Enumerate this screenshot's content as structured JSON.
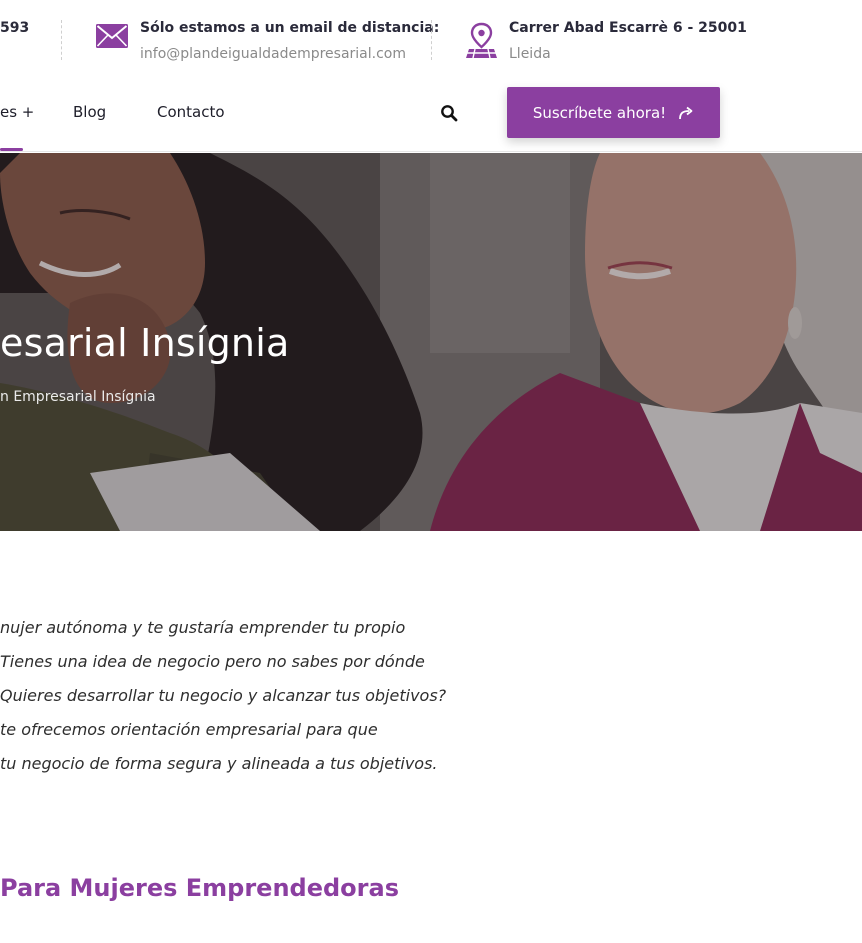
{
  "topbar": {
    "phone_fragment": "593",
    "email": {
      "title": "Sólo estamos a un email de distancia:",
      "value": "info@plandeigualdadempresarial.com",
      "icon": "envelope-icon"
    },
    "address": {
      "title": "Carrer Abad Escarrè 6 - 25001",
      "city": "Lleida",
      "icon": "map-pin-icon"
    }
  },
  "nav": {
    "items": [
      {
        "label": "es +"
      },
      {
        "label": "Blog"
      },
      {
        "label": "Contacto"
      }
    ],
    "search_icon": "search-icon",
    "cta_label": "Suscríbete ahora!",
    "cta_icon": "share-arrow-icon"
  },
  "hero": {
    "title": "esarial Insígnia",
    "breadcrumb": "n Empresarial Insígnia"
  },
  "intro": {
    "lines": [
      "nujer autónoma y te gustaría emprender tu propio",
      "Tienes una idea de negocio pero no sabes por dónde",
      "Quieres desarrollar tu negocio y alcanzar tus objetivos?",
      "te ofrecemos orientación empresarial para que",
      "tu negocio de forma segura y alineada a tus objetivos."
    ]
  },
  "section": {
    "heading": "Para Mujeres Emprendedoras"
  },
  "colors": {
    "brand": "#8b3fa0",
    "text_dark": "#1e1e2a",
    "text_muted": "#8a8a8a"
  }
}
